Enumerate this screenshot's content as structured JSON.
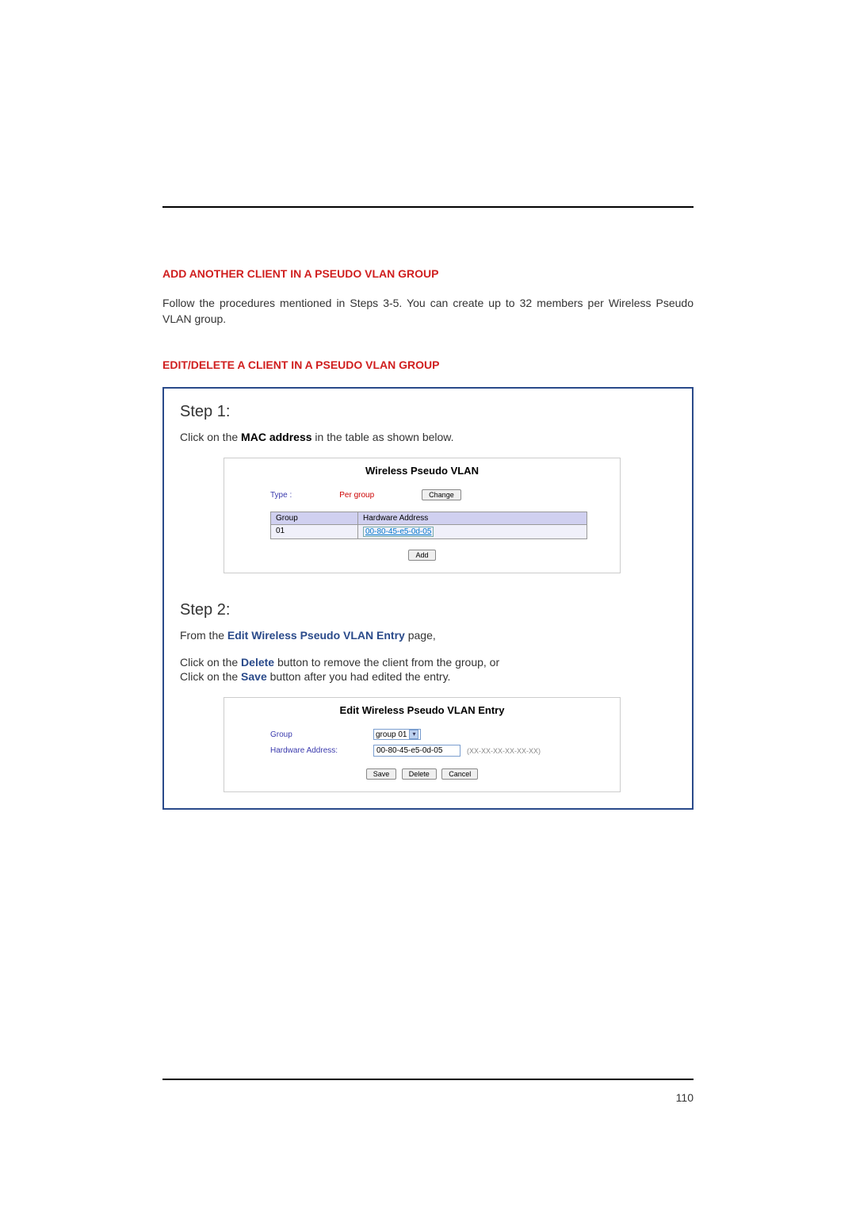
{
  "section1": {
    "heading": "ADD ANOTHER CLIENT IN A PSEUDO VLAN GROUP",
    "body": "Follow the procedures mentioned in Steps 3-5. You can create up to 32 members per Wireless Pseudo VLAN group."
  },
  "section2": {
    "heading": "EDIT/DELETE A CLIENT IN A PSEUDO VLAN GROUP"
  },
  "step1": {
    "title": "Step 1:",
    "text_before": "Click on the ",
    "text_bold": "MAC address",
    "text_after": " in the table as shown below.",
    "panel_title": "Wireless Pseudo VLAN",
    "type_label": "Type :",
    "type_value": "Per group",
    "change_btn": "Change",
    "table": {
      "col_group": "Group",
      "col_addr": "Hardware Address",
      "row_group": "01",
      "row_mac": "00-80-45-e5-0d-05"
    },
    "add_btn": "Add"
  },
  "step2": {
    "title": "Step 2:",
    "line1_before": "From the ",
    "line1_bold": "Edit Wireless Pseudo VLAN Entry",
    "line1_after": " page,",
    "line2_before": "Click on the ",
    "line2_bold": "Delete",
    "line2_after": " button to remove the client from the group, or",
    "line3_before": "Click on the ",
    "line3_bold": "Save",
    "line3_after": " button after you had edited the entry.",
    "panel_title": "Edit Wireless Pseudo VLAN Entry",
    "form": {
      "group_label": "Group",
      "group_value": "group 01",
      "addr_label": "Hardware Address:",
      "addr_value": "00-80-45-e5-0d-05",
      "addr_hint": "(XX-XX-XX-XX-XX-XX)",
      "save_btn": "Save",
      "delete_btn": "Delete",
      "cancel_btn": "Cancel"
    }
  },
  "page_number": "110"
}
